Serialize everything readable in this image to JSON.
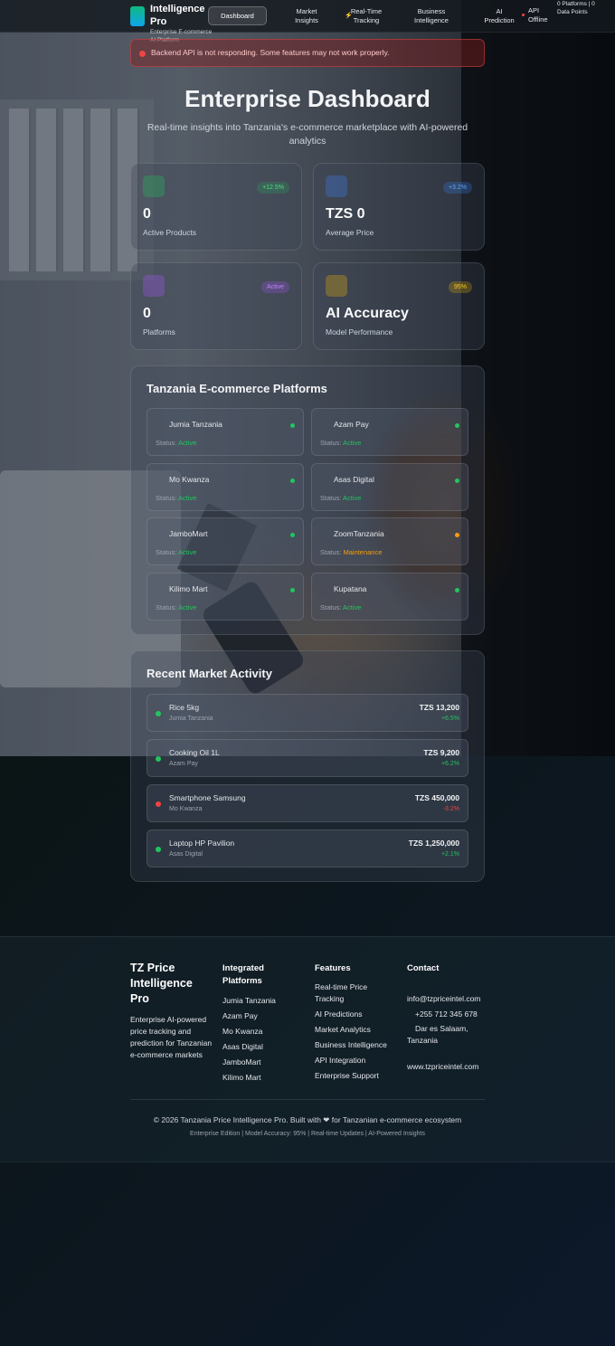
{
  "nav": {
    "brand_title": "Intelligence Pro",
    "brand_subtitle": "Enterprise E-commerce AI Platform",
    "links": [
      "Dashboard",
      "Market Insights",
      "Real-Time Tracking",
      "Business Intelligence",
      "AI Prediction"
    ],
    "api_status": "API Offline",
    "counts": "0 Platforms | 0 Data Points"
  },
  "alert": {
    "text": "Backend API is not responding. Some features may not work properly."
  },
  "hero": {
    "title": "Enterprise Dashboard",
    "subtitle": "Real-time insights into Tanzania's e-commerce marketplace with AI-powered analytics"
  },
  "stats": [
    {
      "value": "0",
      "label": "Active Products",
      "badge": "+12.5%",
      "color": "#22c55e"
    },
    {
      "value": "TZS 0",
      "label": "Average Price",
      "badge": "+3.2%",
      "color": "#3b82f6"
    },
    {
      "value": "0",
      "label": "Platforms",
      "badge": "Active",
      "color": "#a855f7"
    },
    {
      "value": "AI Accuracy",
      "label": "Model Performance",
      "badge": "95%",
      "color": "#eab308"
    }
  ],
  "platforms": {
    "title": "Tanzania E-commerce Platforms",
    "status_prefix": "Status:",
    "items": [
      {
        "name": "Jumia Tanzania",
        "status": "Active"
      },
      {
        "name": "Azam Pay",
        "status": "Active"
      },
      {
        "name": "Mo Kwanza",
        "status": "Active"
      },
      {
        "name": "Asas Digital",
        "status": "Active"
      },
      {
        "name": "JamboMart",
        "status": "Active"
      },
      {
        "name": "ZoomTanzania",
        "status": "Maintenance"
      },
      {
        "name": "Kilimo Mart",
        "status": "Active"
      },
      {
        "name": "Kupatana",
        "status": "Active"
      }
    ]
  },
  "activity": {
    "title": "Recent Market Activity",
    "items": [
      {
        "name": "Rice 5kg",
        "platform": "Jumia Tanzania",
        "price": "TZS 13,200",
        "change": "+6.5%",
        "trend": "up"
      },
      {
        "name": "Cooking Oil 1L",
        "platform": "Azam Pay",
        "price": "TZS 9,200",
        "change": "+6.2%",
        "trend": "up"
      },
      {
        "name": "Smartphone Samsung",
        "platform": "Mo Kwanza",
        "price": "TZS 450,000",
        "change": "-3.2%",
        "trend": "down"
      },
      {
        "name": "Laptop HP Pavilion",
        "platform": "Asas Digital",
        "price": "TZS 1,250,000",
        "change": "+2.1%",
        "trend": "up"
      }
    ]
  },
  "footer": {
    "brand": "TZ Price Intelligence Pro",
    "description": "Enterprise AI-powered price tracking and prediction for Tanzanian e-commerce markets",
    "col_platforms_title": "Integrated Platforms",
    "platforms": [
      "Jumia Tanzania",
      "Azam Pay",
      "Mo Kwanza",
      "Asas Digital",
      "JamboMart",
      "Kilimo Mart"
    ],
    "col_features_title": "Features",
    "features": [
      "Real-time Price Tracking",
      "AI Predictions",
      "Market Analytics",
      "Business Intelligence",
      "API Integration",
      "Enterprise Support"
    ],
    "col_contact_title": "Contact",
    "contact": [
      "info@tzpriceintel.com",
      "+255 712 345 678",
      "Dar es Salaam, Tanzania",
      "www.tzpriceintel.com"
    ],
    "copyright": "© 2026 Tanzania Price Intelligence Pro. Built with ❤ for Tanzanian e-commerce ecosystem",
    "meta": "Enterprise Edition | Model Accuracy: 95% | Real-time Updates | AI-Powered Insights"
  },
  "colors": {
    "active": "#22c55e",
    "maintenance": "#f59e0b",
    "down": "#ef4444"
  }
}
